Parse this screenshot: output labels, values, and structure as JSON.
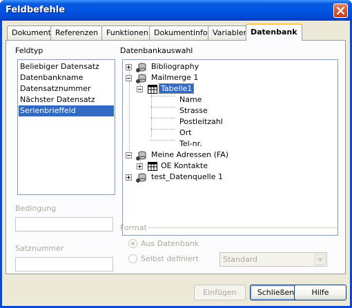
{
  "window": {
    "title": "Feldbefehle"
  },
  "tabs": [
    {
      "label": "Dokument",
      "active": false
    },
    {
      "label": "Referenzen",
      "active": false
    },
    {
      "label": "Funktionen",
      "active": false
    },
    {
      "label": "Dokumentinfo",
      "active": false
    },
    {
      "label": "Variablen",
      "active": false
    },
    {
      "label": "Datenbank",
      "active": true
    }
  ],
  "feldtyp": {
    "label": "Feldtyp",
    "items": [
      {
        "label": "Beliebiger Datensatz",
        "selected": false
      },
      {
        "label": "Datenbankname",
        "selected": false
      },
      {
        "label": "Datensatznummer",
        "selected": false
      },
      {
        "label": "Nächster Datensatz",
        "selected": false
      },
      {
        "label": "Serienbrieffeld",
        "selected": true
      }
    ]
  },
  "datenbankauswahl": {
    "label": "Datenbankauswahl",
    "tree": [
      {
        "label": "Bibliography",
        "expanded": false
      },
      {
        "label": "Mailmerge 1",
        "expanded": true
      },
      {
        "label": "Tabelle1",
        "expanded": true,
        "selected": true
      },
      {
        "label": "Name"
      },
      {
        "label": "Strasse"
      },
      {
        "label": "Postleitzahl"
      },
      {
        "label": "Ort"
      },
      {
        "label": "Tel-nr."
      },
      {
        "label": "Meine Adressen (FA)",
        "expanded": true
      },
      {
        "label": "OE Kontakte",
        "expanded": false
      },
      {
        "label": "test_Datenquelle 1",
        "expanded": false
      }
    ]
  },
  "bedingung": {
    "label": "Bedingung",
    "value": ""
  },
  "satznummer": {
    "label": "Satznummer",
    "value": ""
  },
  "format": {
    "label": "Format",
    "options": [
      {
        "label": "Aus Datenbank",
        "checked": true
      },
      {
        "label": "Selbst definiert",
        "checked": false
      }
    ],
    "select_value": "Standard"
  },
  "buttons": {
    "insert": "Einfügen",
    "close": "Schließen",
    "help": "Hilfe"
  },
  "icons": {
    "close": "close-icon",
    "database": "database-icon",
    "table": "table-icon"
  },
  "colors": {
    "title_bar": "#0054e3",
    "selection": "#316ac5",
    "dialog_bg": "#ece9d8",
    "tab_highlight": "#ffc83c"
  }
}
